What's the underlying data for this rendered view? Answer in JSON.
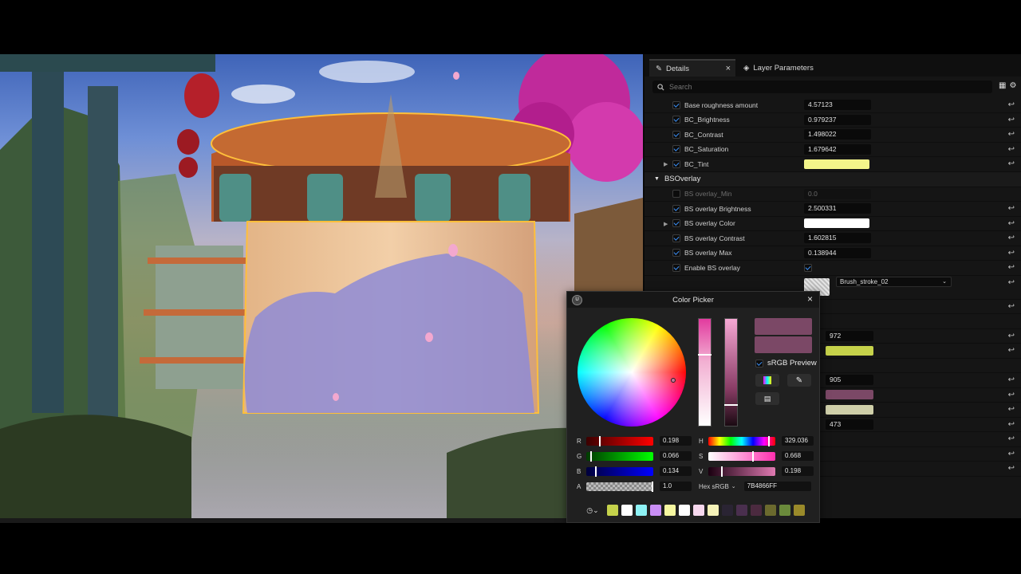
{
  "details_panel": {
    "tabs": [
      {
        "label": "Details",
        "close": "×"
      },
      {
        "label": "Layer Parameters"
      }
    ],
    "search_placeholder": "Search",
    "rows": [
      {
        "name": "Base roughness amount",
        "value": "4.57123",
        "checked": true
      },
      {
        "name": "BC_Brightness",
        "value": "0.979237",
        "checked": true
      },
      {
        "name": "BC_Contrast",
        "value": "1.498022",
        "checked": true
      },
      {
        "name": "BC_Saturation",
        "value": "1.679642",
        "checked": true
      },
      {
        "name": "BC_Tint",
        "color": "#f3f58a",
        "checked": true
      }
    ],
    "section": "BSOverlay",
    "overlay_rows": [
      {
        "name": "BS overlay_Min",
        "value": "0.0",
        "checked": false
      },
      {
        "name": "BS overlay Brightness",
        "value": "2.500331",
        "checked": true
      },
      {
        "name": "BS overlay Color",
        "color": "#ffffff",
        "checked": true
      },
      {
        "name": "BS overlay Contrast",
        "value": "1.602815",
        "checked": true
      },
      {
        "name": "BS overlay Max",
        "value": "0.138944",
        "checked": true
      },
      {
        "name": "Enable BS overlay",
        "checked": true
      }
    ],
    "texture_dropdown": "Brush_stroke_02",
    "partial_values": [
      "972",
      "905",
      "473"
    ],
    "partial_colors": [
      "#c6d24a",
      "#7b4866",
      "#cfcfa9"
    ]
  },
  "color_picker": {
    "title": "Color Picker",
    "close": "×",
    "srgb_preview_label": "sRGB Preview",
    "srgb_preview_checked": true,
    "current_color": "#7B4866",
    "channels": {
      "r": {
        "label": "R",
        "value": "0.198",
        "level": 0.198
      },
      "g": {
        "label": "G",
        "value": "0.066",
        "level": 0.066
      },
      "b": {
        "label": "B",
        "value": "0.134",
        "level": 0.134
      },
      "a": {
        "label": "A",
        "value": "1.0",
        "level": 1.0
      },
      "h": {
        "label": "H",
        "value": "329.036",
        "level": 0.914
      },
      "s": {
        "label": "S",
        "value": "0.668",
        "level": 0.668
      },
      "v": {
        "label": "V",
        "value": "0.198",
        "level": 0.198
      }
    },
    "hex_label": "Hex sRGB",
    "hex_value": "7B4866FF",
    "saved_colors": [
      "#c5d24b",
      "#ffffff",
      "#8ef2f5",
      "#c98ef5",
      "#f6f7a0",
      "#ffffff",
      "#f7d8ee",
      "#f5f2b8",
      "#2a2433",
      "#4a2f4e",
      "#4b2a3f",
      "#6b6a2e",
      "#6a8a3b",
      "#9a8a2a"
    ]
  }
}
